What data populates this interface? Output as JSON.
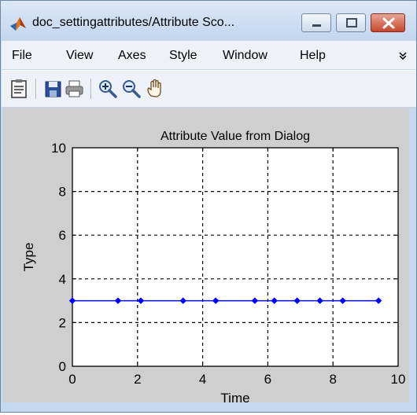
{
  "window": {
    "title": "doc_settingattributes/Attribute Sco...",
    "icons": {
      "app": "matlab-icon",
      "minimize": "minimize-icon",
      "maximize": "maximize-icon",
      "close": "close-icon"
    }
  },
  "menubar": {
    "items": [
      "File",
      "View",
      "Axes",
      "Style",
      "Window",
      "Help"
    ],
    "overflow_icon": "chevron-double-down-icon"
  },
  "toolbar": {
    "icons": [
      "clipboard-icon",
      "save-icon",
      "print-icon",
      "zoom-in-icon",
      "zoom-out-icon",
      "pan-hand-icon"
    ]
  },
  "colors": {
    "window_frame": "#c4d8ee",
    "figure_bg": "#cfcfcf",
    "plot_bg": "#ffffff",
    "series": "#0000ff",
    "grid": "#000000"
  },
  "chart_data": {
    "type": "line",
    "title": "Attribute Value from Dialog",
    "xlabel": "Time",
    "ylabel": "Type",
    "xlim": [
      0,
      10
    ],
    "ylim": [
      0,
      10
    ],
    "xticks": [
      "0",
      "2",
      "4",
      "6",
      "8",
      "10"
    ],
    "yticks": [
      "0",
      "2",
      "4",
      "6",
      "8",
      "10"
    ],
    "grid": true,
    "grid_style": "dashed",
    "series": [
      {
        "marker": "diamond",
        "color": "#0000ff",
        "x": [
          0,
          1.4,
          2.1,
          3.4,
          4.4,
          5.6,
          6.2,
          6.9,
          7.6,
          8.3,
          9.4
        ],
        "y": [
          3,
          3,
          3,
          3,
          3,
          3,
          3,
          3,
          3,
          3,
          3
        ]
      }
    ]
  }
}
